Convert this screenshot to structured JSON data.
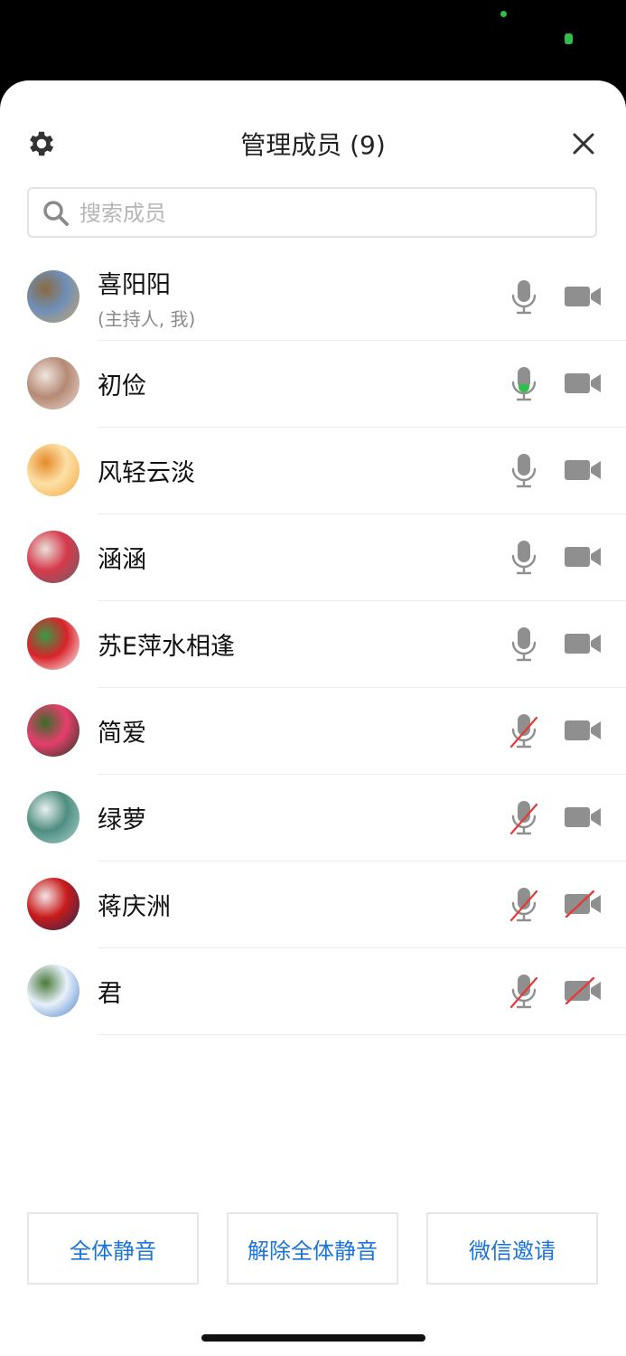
{
  "header": {
    "title": "管理成员 (9)"
  },
  "search": {
    "placeholder": "搜索成员"
  },
  "members": [
    {
      "name": "喜阳阳",
      "sub": "(主持人, 我)",
      "mic": "on",
      "cam": "on",
      "avatar_colors": [
        "#c9a66b",
        "#6e8fb8",
        "#8a6a3f"
      ]
    },
    {
      "name": "初俭",
      "mic": "speaking",
      "cam": "on",
      "avatar_colors": [
        "#e9d8cf",
        "#b58a75",
        "#f0e6de"
      ]
    },
    {
      "name": "风轻云淡",
      "mic": "on",
      "cam": "on",
      "avatar_colors": [
        "#f2a540",
        "#fde1a6",
        "#e58a2a"
      ]
    },
    {
      "name": "涵涵",
      "mic": "on",
      "cam": "on",
      "avatar_colors": [
        "#6b5f63",
        "#d63a4d",
        "#e8e1d8"
      ]
    },
    {
      "name": "苏E萍水相逢",
      "mic": "on",
      "cam": "on",
      "avatar_colors": [
        "#ffffff",
        "#d8232a",
        "#3a9a47"
      ]
    },
    {
      "name": "简爱",
      "mic": "muted",
      "cam": "on",
      "avatar_colors": [
        "#1e3a1f",
        "#e63e6d",
        "#3d6b2c"
      ]
    },
    {
      "name": "绿萝",
      "mic": "muted",
      "cam": "on",
      "avatar_colors": [
        "#a9d3d2",
        "#4f8e7f",
        "#e6f0ef"
      ]
    },
    {
      "name": "蒋庆洲",
      "mic": "muted",
      "cam": "off",
      "avatar_colors": [
        "#1e2c55",
        "#c91a1a",
        "#f2e6e6"
      ]
    },
    {
      "name": "君",
      "mic": "muted",
      "cam": "off",
      "avatar_colors": [
        "#4a7fc9",
        "#e8f1fb",
        "#4b7a3a"
      ]
    }
  ],
  "buttons": {
    "mute_all": "全体静音",
    "unmute_all": "解除全体静音",
    "wechat_invite": "微信邀请"
  },
  "colors": {
    "accent": "#1a73d9",
    "speaking": "#2fbf4a",
    "muted": "#e53935",
    "icon_gray": "#8f8f8f"
  }
}
